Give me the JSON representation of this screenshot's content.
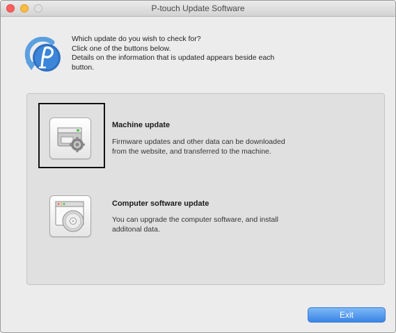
{
  "window": {
    "title": "P-touch Update Software"
  },
  "intro": {
    "line1": "Which update do you wish to check for?",
    "line2": "Click one of the buttons below.",
    "line3": "Details on the information that is updated appears beside each",
    "line4": "button."
  },
  "updates": [
    {
      "title": "Machine update",
      "desc_line1": "Firmware updates and other data can be downloaded",
      "desc_line2": "from the website, and transferred to the machine.",
      "icon": "machine-gear-icon",
      "selected": true
    },
    {
      "title": "Computer software update",
      "desc_line1": "You can upgrade the computer software, and install",
      "desc_line2": "additonal data.",
      "icon": "window-disc-icon",
      "selected": false
    }
  ],
  "footer": {
    "exit_label": "Exit"
  },
  "colors": {
    "accent": "#3a84e6",
    "close": "#fc605c",
    "minimize": "#fdbc40",
    "highlight_border": "#111111"
  }
}
